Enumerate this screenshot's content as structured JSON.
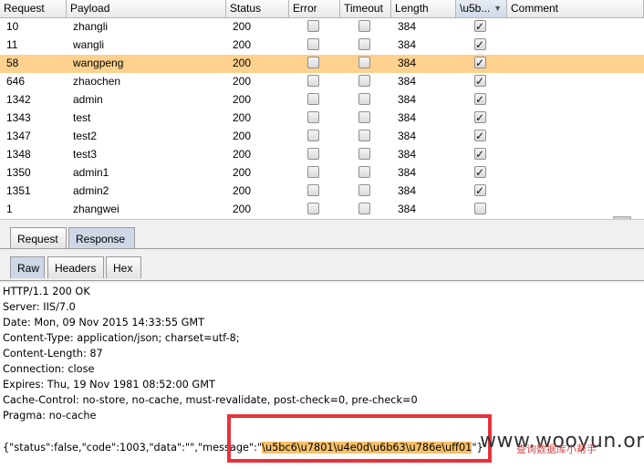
{
  "table": {
    "columns": [
      "Request",
      "Payload",
      "Status",
      "Error",
      "Timeout",
      "Length",
      "\\u5b...",
      "Comment"
    ],
    "sort_arrow": "▼",
    "rows": [
      {
        "request": "10",
        "payload": "zhangli",
        "status": "200",
        "error": false,
        "timeout": false,
        "length": "384",
        "u": true,
        "comment": "",
        "selected": false
      },
      {
        "request": "11",
        "payload": "wangli",
        "status": "200",
        "error": false,
        "timeout": false,
        "length": "384",
        "u": true,
        "comment": "",
        "selected": false
      },
      {
        "request": "58",
        "payload": "wangpeng",
        "status": "200",
        "error": false,
        "timeout": false,
        "length": "384",
        "u": true,
        "comment": "",
        "selected": true
      },
      {
        "request": "646",
        "payload": "zhaochen",
        "status": "200",
        "error": false,
        "timeout": false,
        "length": "384",
        "u": true,
        "comment": "",
        "selected": false
      },
      {
        "request": "1342",
        "payload": "admin",
        "status": "200",
        "error": false,
        "timeout": false,
        "length": "384",
        "u": true,
        "comment": "",
        "selected": false
      },
      {
        "request": "1343",
        "payload": "test",
        "status": "200",
        "error": false,
        "timeout": false,
        "length": "384",
        "u": true,
        "comment": "",
        "selected": false
      },
      {
        "request": "1347",
        "payload": "test2",
        "status": "200",
        "error": false,
        "timeout": false,
        "length": "384",
        "u": true,
        "comment": "",
        "selected": false
      },
      {
        "request": "1348",
        "payload": "test3",
        "status": "200",
        "error": false,
        "timeout": false,
        "length": "384",
        "u": true,
        "comment": "",
        "selected": false
      },
      {
        "request": "1350",
        "payload": "admin1",
        "status": "200",
        "error": false,
        "timeout": false,
        "length": "384",
        "u": true,
        "comment": "",
        "selected": false
      },
      {
        "request": "1351",
        "payload": "admin2",
        "status": "200",
        "error": false,
        "timeout": false,
        "length": "384",
        "u": true,
        "comment": "",
        "selected": false
      },
      {
        "request": "1",
        "payload": "zhangwei",
        "status": "200",
        "error": false,
        "timeout": false,
        "length": "384",
        "u": false,
        "comment": "",
        "selected": false
      }
    ]
  },
  "tabs_top": {
    "request": "Request",
    "response": "Response",
    "active": "response"
  },
  "tabs_view": {
    "raw": "Raw",
    "headers": "Headers",
    "hex": "Hex",
    "active": "raw"
  },
  "response": {
    "headers": [
      "HTTP/1.1 200 OK",
      "Server: IIS/7.0",
      "Date: Mon, 09 Nov 2015 14:33:55 GMT",
      "Content-Type: application/json; charset=utf-8;",
      "Content-Length: 87",
      "Connection: close",
      "Expires: Thu, 19 Nov 1981 08:52:00 GMT",
      "Cache-Control: no-store, no-cache, must-revalidate, post-check=0, pre-check=0",
      "Pragma: no-cache"
    ],
    "body_prefix": "{\"status\":false,\"code\":1003,\"data\":\"\",\"message\":\"",
    "body_highlight": "\\u5bc6\\u7801\\u4e0d\\u6b63\\u786e\\uff01",
    "body_suffix": "\"}"
  },
  "watermark": {
    "text": "www.wooyun.org",
    "sub": "查询数据库小帮手"
  },
  "colors": {
    "selected_row": "#ffd18e",
    "highlight": "#f6c06a",
    "red_box": "#e8323a",
    "active_tab": "#cdd7e6"
  }
}
